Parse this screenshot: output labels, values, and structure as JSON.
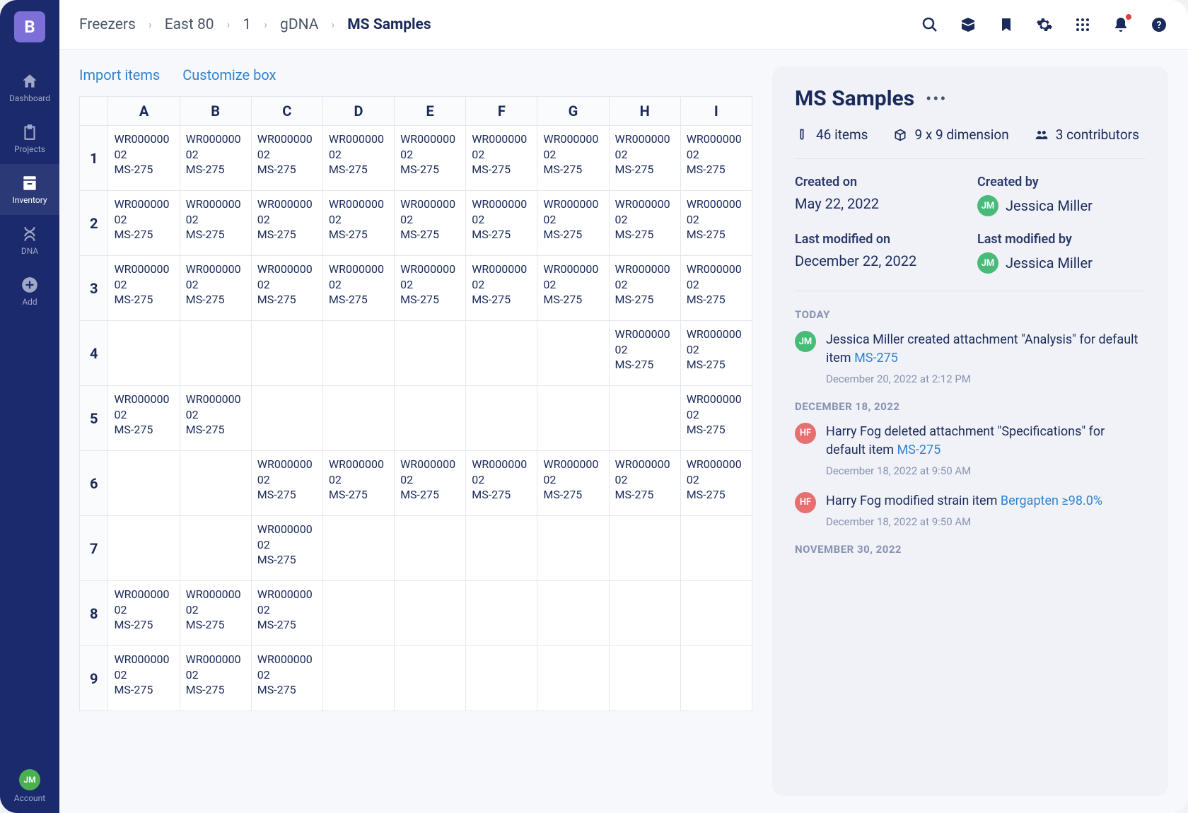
{
  "sidebar": {
    "logo": "B",
    "items": [
      {
        "label": "Dashboard"
      },
      {
        "label": "Projects"
      },
      {
        "label": "Inventory"
      },
      {
        "label": "DNA"
      },
      {
        "label": "Add"
      }
    ],
    "account": {
      "initials": "JM",
      "label": "Account"
    }
  },
  "breadcrumbs": [
    "Freezers",
    "East 80",
    "1",
    "gDNA",
    "MS Samples"
  ],
  "actions": {
    "import": "Import items",
    "customize": "Customize box"
  },
  "grid": {
    "columns": [
      "A",
      "B",
      "C",
      "D",
      "E",
      "F",
      "G",
      "H",
      "I"
    ],
    "rowCount": 9,
    "sample": {
      "code": "WR00000002",
      "name": "MS-275"
    },
    "filled": {
      "1": [
        0,
        1,
        2,
        3,
        4,
        5,
        6,
        7,
        8
      ],
      "2": [
        0,
        1,
        2,
        3,
        4,
        5,
        6,
        7,
        8
      ],
      "3": [
        0,
        1,
        2,
        3,
        4,
        5,
        6,
        7,
        8
      ],
      "4": [
        7,
        8
      ],
      "5": [
        0,
        1,
        8
      ],
      "6": [
        2,
        3,
        4,
        5,
        6,
        7,
        8
      ],
      "7": [
        2
      ],
      "8": [
        0,
        1,
        2
      ],
      "9": [
        0,
        1,
        2
      ]
    }
  },
  "details": {
    "title": "MS Samples",
    "stats": {
      "items": "46 items",
      "dimension": "9 x 9 dimension",
      "contributors": "3 contributors"
    },
    "meta": {
      "createdOnLabel": "Created on",
      "createdOn": "May 22, 2022",
      "createdByLabel": "Created by",
      "createdByInitials": "JM",
      "createdByName": "Jessica Miller",
      "modifiedOnLabel": "Last modified on",
      "modifiedOn": "December 22, 2022",
      "modifiedByLabel": "Last modified by",
      "modifiedByInitials": "JM",
      "modifiedByName": "Jessica Miller"
    },
    "activity": [
      {
        "sectionLabel": "TODAY"
      },
      {
        "avatar": "JM",
        "avatarColor": "av-green",
        "textBefore": "Jessica Miller created attachment \"Analysis\" for default item ",
        "link": "MS-275",
        "time": "December 20, 2022 at 2:12 PM"
      },
      {
        "sectionLabel": "DECEMBER 18, 2022"
      },
      {
        "avatar": "HF",
        "avatarColor": "av-red",
        "textBefore": "Harry Fog deleted attachment \"Specifications\" for default item ",
        "link": "MS-275",
        "time": "December 18, 2022 at 9:50 AM"
      },
      {
        "avatar": "HF",
        "avatarColor": "av-red",
        "textBefore": "Harry Fog modified strain item ",
        "link": "Bergapten ≥98.0%",
        "time": "December 18, 2022 at 9:50 AM"
      },
      {
        "sectionLabel": "NOVEMBER 30, 2022"
      }
    ]
  }
}
